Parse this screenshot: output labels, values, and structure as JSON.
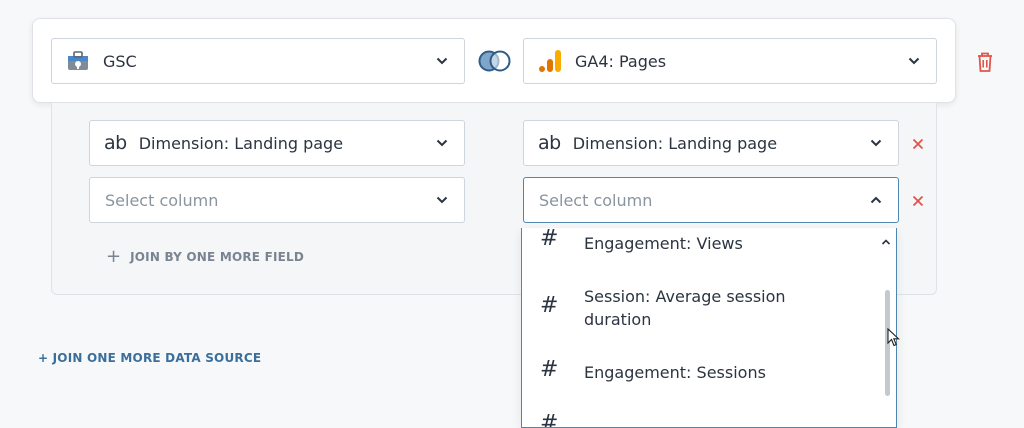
{
  "source_row": {
    "left_source": {
      "label": "GSC",
      "icon": "gsc-toolbox-icon"
    },
    "right_source": {
      "label": "GA4: Pages",
      "icon": "ga4-bars-icon"
    },
    "join_icon": "venn-circles-icon",
    "delete_icon": "trash-icon"
  },
  "join_fields": {
    "rows": [
      {
        "left": "Dimension: Landing page",
        "right": "Dimension: Landing page",
        "type_icon": "ab"
      },
      {
        "left_placeholder": "Select column",
        "right_placeholder": "Select column"
      }
    ],
    "add_field_plus": "+",
    "add_field_label": "JOIN BY ONE MORE FIELD"
  },
  "add_source_label": "+ JOIN ONE MORE DATA SOURCE",
  "dropdown": {
    "hash_symbol": "#",
    "options": [
      "Engagement: Views",
      "Session: Average session duration",
      "Engagement: Sessions"
    ]
  },
  "colors": {
    "accent": "#4e86b3",
    "link": "#3a6f9c",
    "danger": "#e0554a",
    "ga4_orange": "#f9ab00",
    "ga4_dark": "#e37400"
  }
}
